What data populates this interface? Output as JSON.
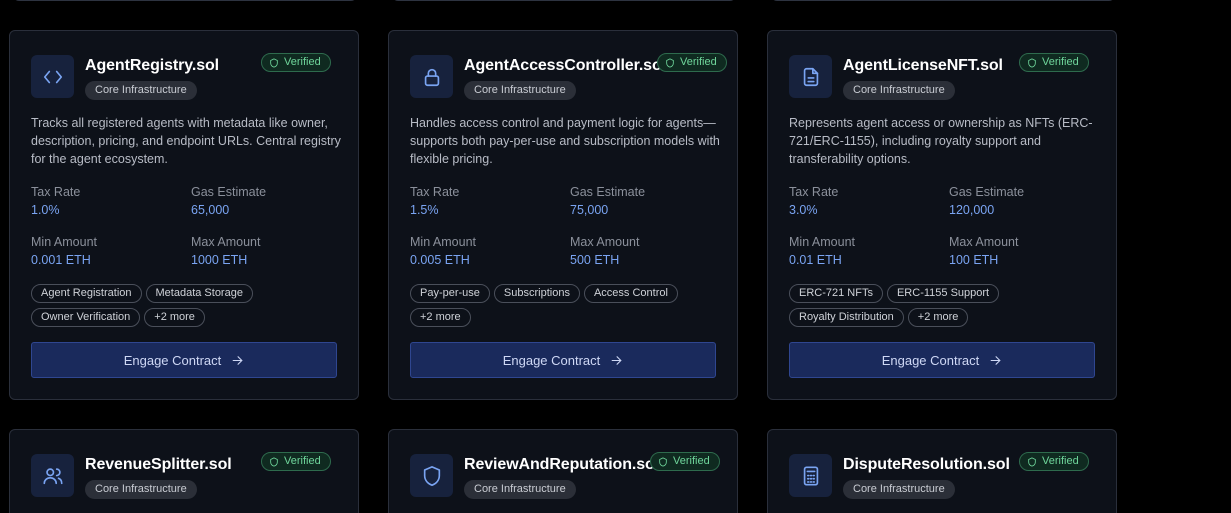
{
  "cards": [
    {
      "name": "AgentRegistry.sol",
      "category": "Core Infrastructure",
      "verified": "Verified",
      "icon": "code-icon",
      "description": "Tracks all registered agents with metadata like owner, description, pricing, and endpoint URLs. Central registry for the agent ecosystem.",
      "tax_rate_label": "Tax Rate",
      "tax_rate": "1.0%",
      "gas_label": "Gas Estimate",
      "gas": "65,000",
      "min_label": "Min Amount",
      "min": "0.001 ETH",
      "max_label": "Max Amount",
      "max": "1000 ETH",
      "tags": [
        "Agent Registration",
        "Metadata Storage",
        "Owner Verification",
        "+2 more"
      ],
      "button": "Engage Contract"
    },
    {
      "name": "AgentAccessController.sol",
      "category": "Core Infrastructure",
      "verified": "Verified",
      "icon": "lock-icon",
      "description": "Handles access control and payment logic for agents—supports both pay-per-use and subscription models with flexible pricing.",
      "tax_rate_label": "Tax Rate",
      "tax_rate": "1.5%",
      "gas_label": "Gas Estimate",
      "gas": "75,000",
      "min_label": "Min Amount",
      "min": "0.005 ETH",
      "max_label": "Max Amount",
      "max": "500 ETH",
      "tags": [
        "Pay-per-use",
        "Subscriptions",
        "Access Control",
        "+2 more"
      ],
      "button": "Engage Contract"
    },
    {
      "name": "AgentLicenseNFT.sol",
      "category": "Core Infrastructure",
      "verified": "Verified",
      "icon": "document-icon",
      "description": "Represents agent access or ownership as NFTs (ERC-721/ERC-1155), including royalty support and transferability options.",
      "tax_rate_label": "Tax Rate",
      "tax_rate": "3.0%",
      "gas_label": "Gas Estimate",
      "gas": "120,000",
      "min_label": "Min Amount",
      "min": "0.01 ETH",
      "max_label": "Max Amount",
      "max": "100 ETH",
      "tags": [
        "ERC-721 NFTs",
        "ERC-1155 Support",
        "Royalty Distribution",
        "+2 more"
      ],
      "button": "Engage Contract"
    },
    {
      "name": "RevenueSplitter.sol",
      "category": "Core Infrastructure",
      "verified": "Verified",
      "icon": "users-icon"
    },
    {
      "name": "ReviewAndReputation.sol",
      "category": "Core Infrastructure",
      "verified": "Verified",
      "icon": "shield-icon"
    },
    {
      "name": "DisputeResolution.sol",
      "category": "Core Infrastructure",
      "verified": "Verified",
      "icon": "calculator-icon"
    }
  ]
}
